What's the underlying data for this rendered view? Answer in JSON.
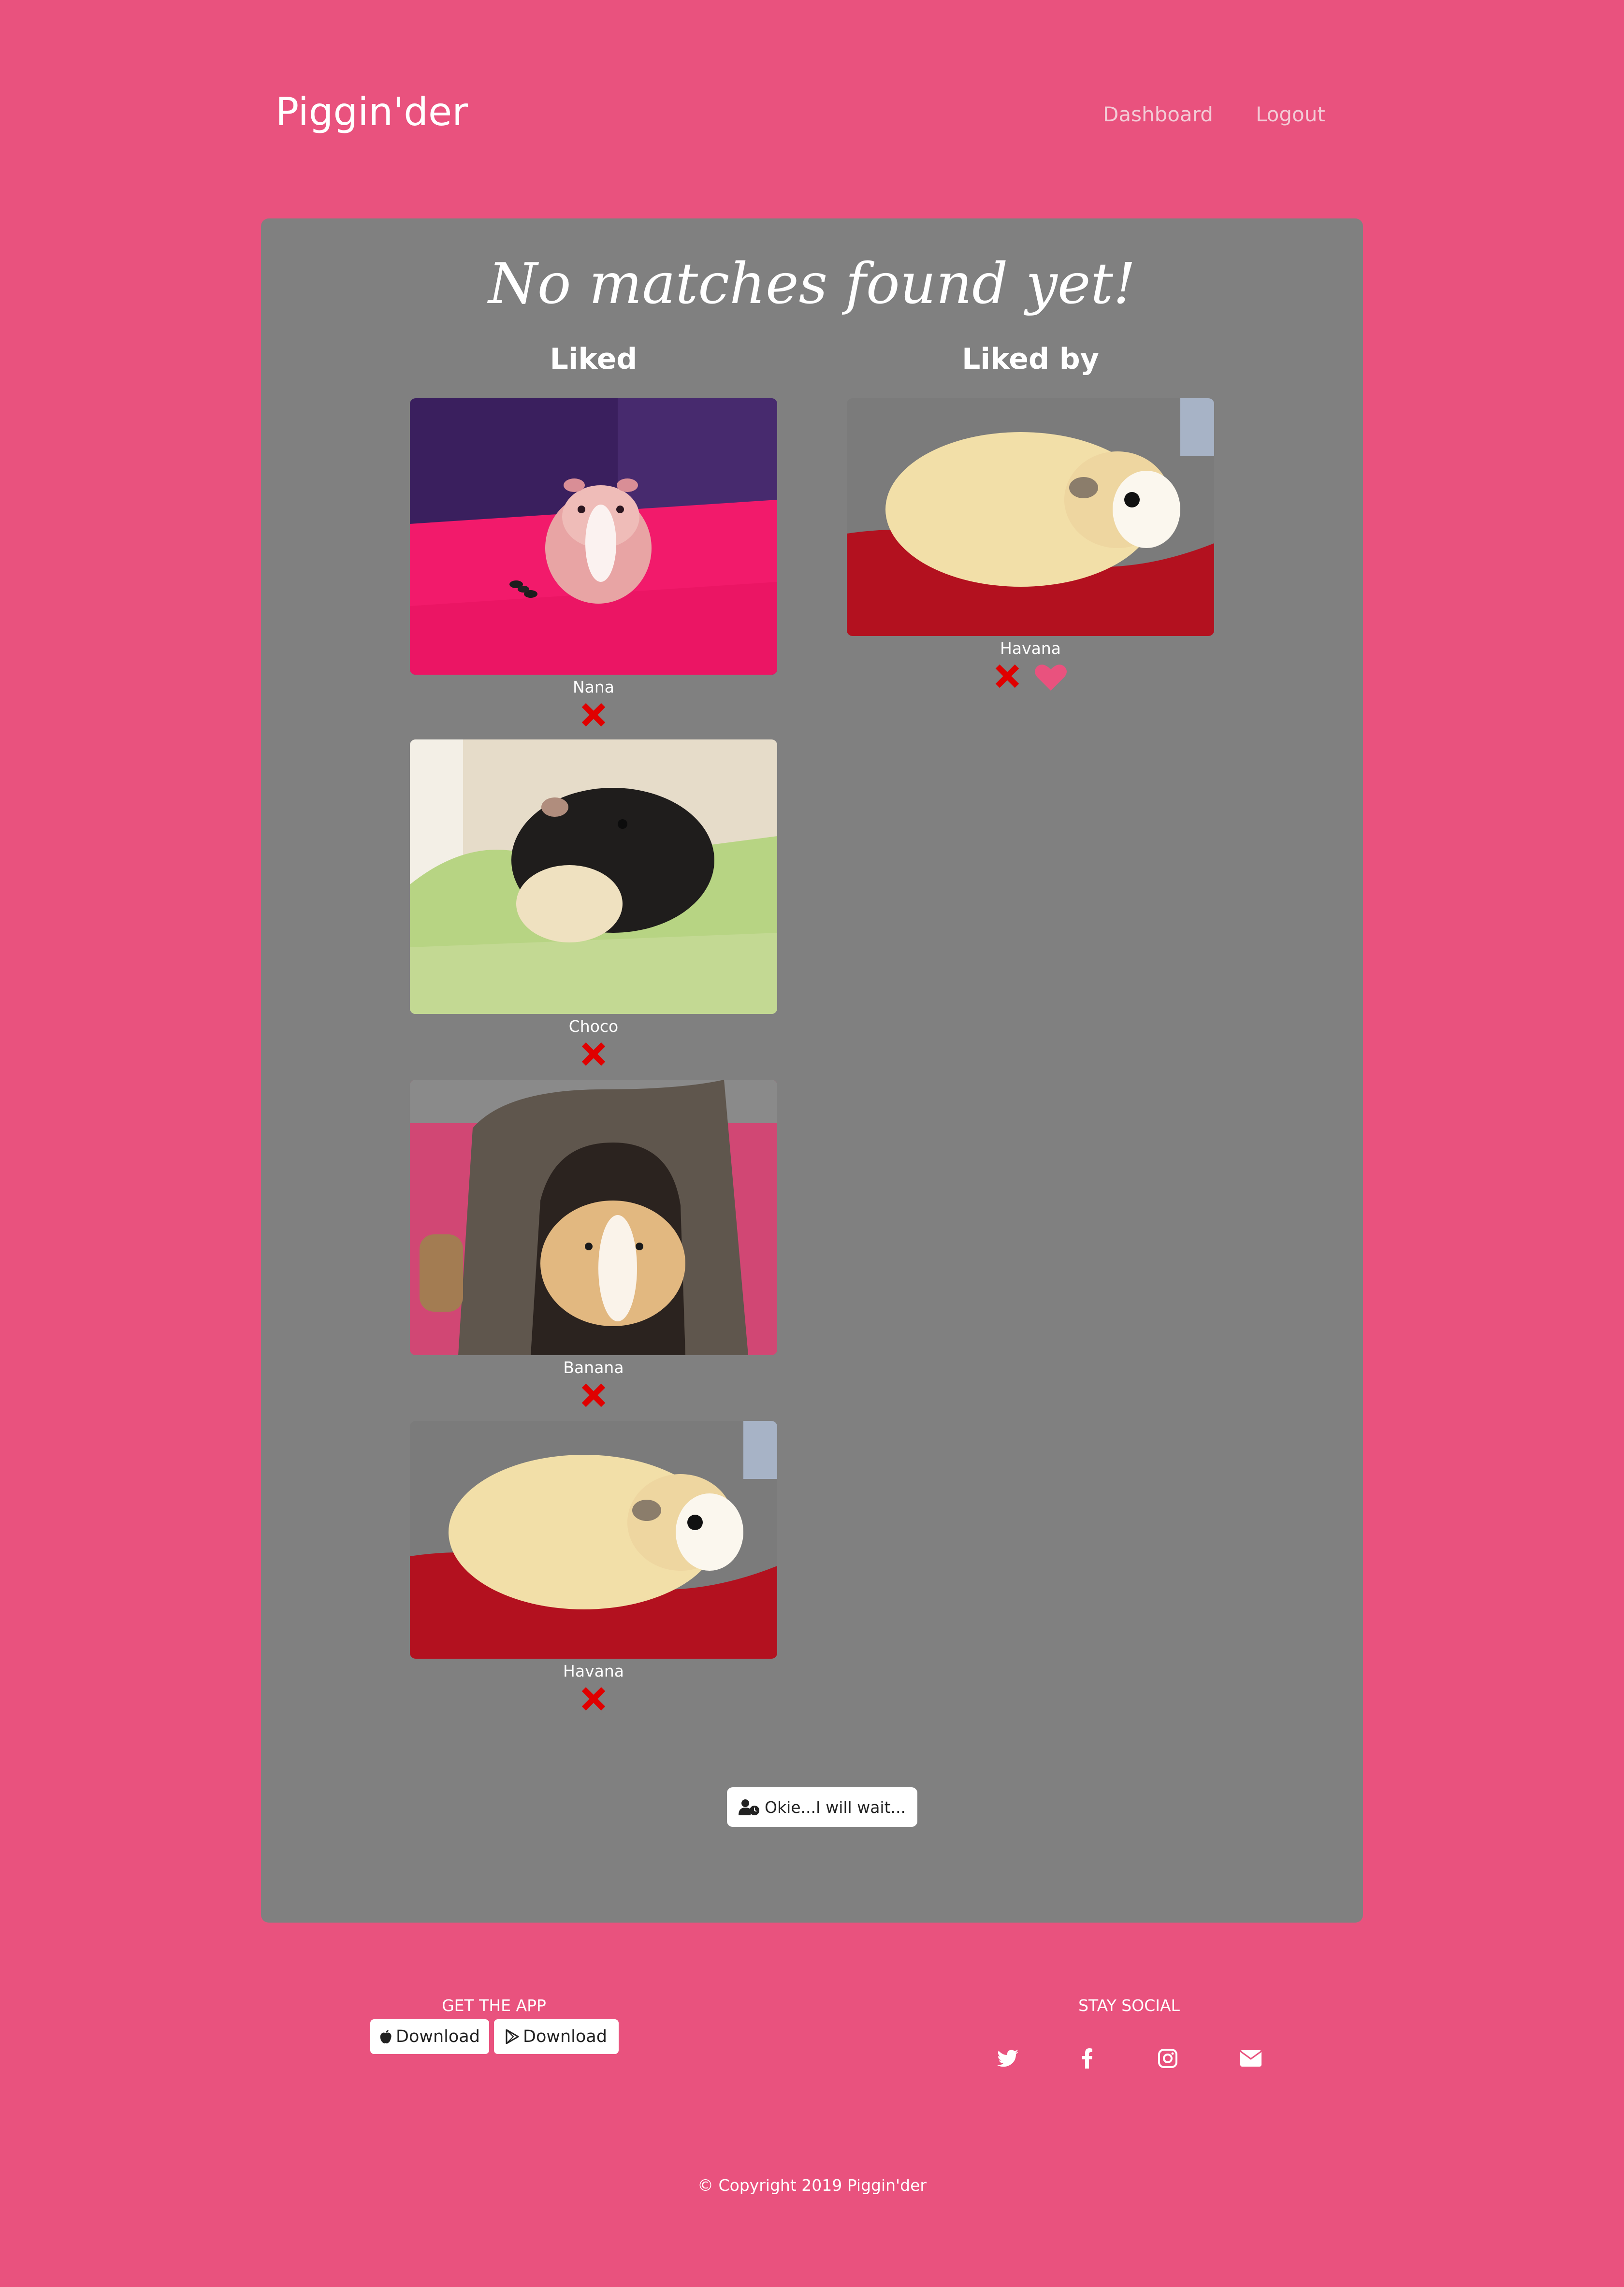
{
  "header": {
    "brand": "Piggin'der",
    "nav": {
      "dashboard": "Dashboard",
      "logout": "Logout"
    }
  },
  "main": {
    "status_title": "No matches found yet!",
    "liked": {
      "heading": "Liked",
      "items": [
        {
          "name": "Nana"
        },
        {
          "name": "Choco"
        },
        {
          "name": "Banana"
        },
        {
          "name": "Havana"
        }
      ]
    },
    "liked_by": {
      "heading": "Liked by",
      "items": [
        {
          "name": "Havana"
        }
      ]
    },
    "wait_button": "Okie...I will wait..."
  },
  "footer": {
    "get_app": "GET THE APP",
    "download_ios": "Download",
    "download_android": "Download",
    "stay_social": "STAY SOCIAL",
    "social_icons": [
      "twitter-icon",
      "facebook-icon",
      "instagram-icon",
      "envelope-icon"
    ],
    "copyright": "© Copyright 2019 Piggin'der"
  },
  "colors": {
    "background": "#e9527e",
    "panel": "#808080",
    "reject": "#e00000",
    "like": "#e9527e"
  }
}
